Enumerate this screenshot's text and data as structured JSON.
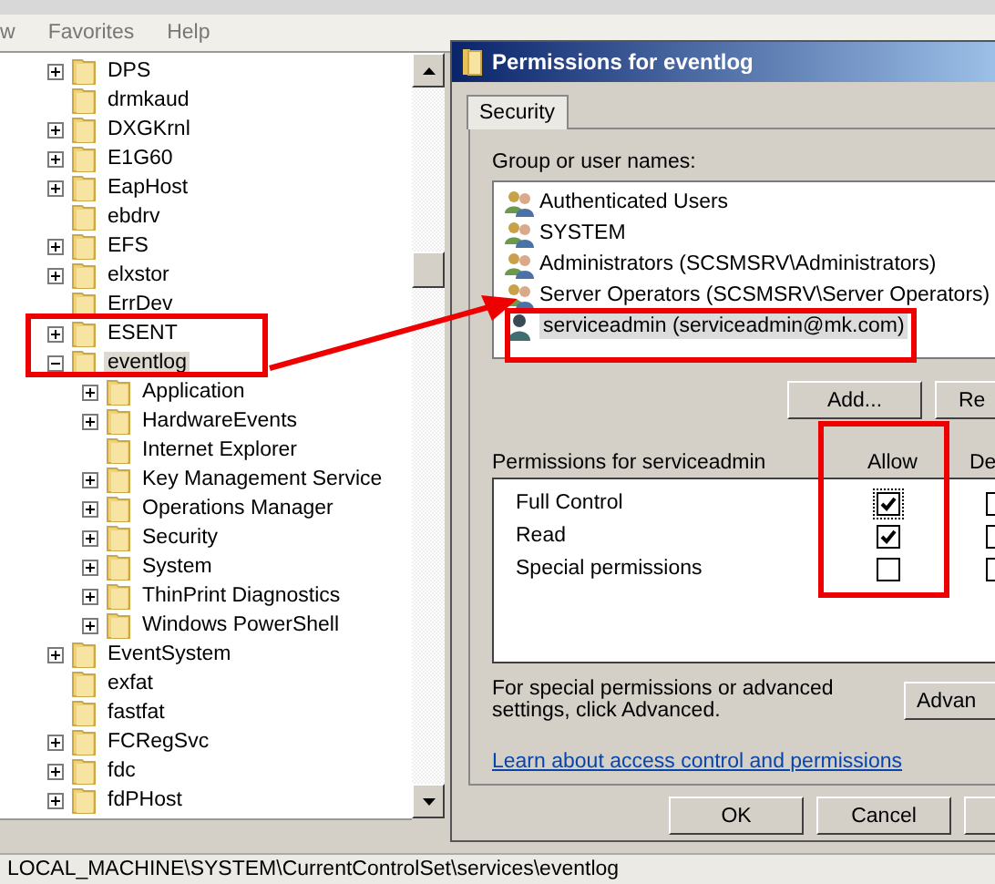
{
  "menu": [
    "w",
    "Favorites",
    "Help"
  ],
  "tree": [
    {
      "label": "DPS",
      "expanded": false,
      "selected": false
    },
    {
      "label": "drmkaud",
      "selected": false
    },
    {
      "label": "DXGKrnl",
      "expanded": false,
      "selected": false
    },
    {
      "label": "E1G60",
      "expanded": false,
      "selected": false
    },
    {
      "label": "EapHost",
      "expanded": false,
      "selected": false
    },
    {
      "label": "ebdrv",
      "selected": false
    },
    {
      "label": "EFS",
      "expanded": false,
      "selected": false
    },
    {
      "label": "elxstor",
      "expanded": false,
      "selected": false
    },
    {
      "label": "ErrDev",
      "selected": false
    },
    {
      "label": "ESENT",
      "expanded": false,
      "selected": false
    },
    {
      "label": "eventlog",
      "expanded": true,
      "selected": true,
      "children": [
        {
          "label": "Application",
          "expanded": false,
          "selected": false
        },
        {
          "label": "HardwareEvents",
          "expanded": false,
          "selected": false
        },
        {
          "label": "Internet Explorer",
          "selected": false
        },
        {
          "label": "Key Management Service",
          "expanded": false,
          "selected": false
        },
        {
          "label": "Operations Manager",
          "expanded": false,
          "selected": false
        },
        {
          "label": "Security",
          "expanded": false,
          "selected": false
        },
        {
          "label": "System",
          "expanded": false,
          "selected": false
        },
        {
          "label": "ThinPrint Diagnostics",
          "expanded": false,
          "selected": false
        },
        {
          "label": "Windows PowerShell",
          "expanded": false,
          "selected": false
        }
      ]
    },
    {
      "label": "EventSystem",
      "expanded": false,
      "selected": false
    },
    {
      "label": "exfat",
      "selected": false
    },
    {
      "label": "fastfat",
      "selected": false
    },
    {
      "label": "FCRegSvc",
      "expanded": false,
      "selected": false
    },
    {
      "label": "fdc",
      "expanded": false,
      "selected": false
    },
    {
      "label": "fdPHost",
      "expanded": false,
      "selected": false
    }
  ],
  "status_bar": "LOCAL_MACHINE\\SYSTEM\\CurrentControlSet\\services\\eventlog",
  "dialog": {
    "title": "Permissions for eventlog",
    "tabs": [
      {
        "label": "Security",
        "selected": true
      }
    ],
    "users_label": "Group or user names:",
    "users": [
      {
        "kind": "group",
        "name": "Authenticated Users",
        "selected": false
      },
      {
        "kind": "group",
        "name": "SYSTEM",
        "selected": false
      },
      {
        "kind": "group",
        "name": "Administrators (SCSMSRV\\Administrators)",
        "selected": false
      },
      {
        "kind": "group",
        "name": "Server Operators (SCSMSRV\\Server Operators)",
        "selected": false
      },
      {
        "kind": "user",
        "name": "serviceadmin (serviceadmin@mk.com)",
        "selected": true
      }
    ],
    "user_buttons": [
      "Add...",
      "Re"
    ],
    "permissions_label": "Permissions for serviceadmin",
    "allow_header": "Allow",
    "deny_header": "De",
    "permissions": [
      {
        "name": "Full Control",
        "allow": true,
        "deny": false
      },
      {
        "name": "Read",
        "allow": true,
        "deny": false
      },
      {
        "name": "Special permissions",
        "allow": false,
        "deny": false
      }
    ],
    "advanced_text": "For special permissions or advanced settings, click Advanced.",
    "advanced_button": "Advan",
    "link": "Learn about access control and permissions",
    "buttons": [
      "OK",
      "Cancel"
    ]
  }
}
